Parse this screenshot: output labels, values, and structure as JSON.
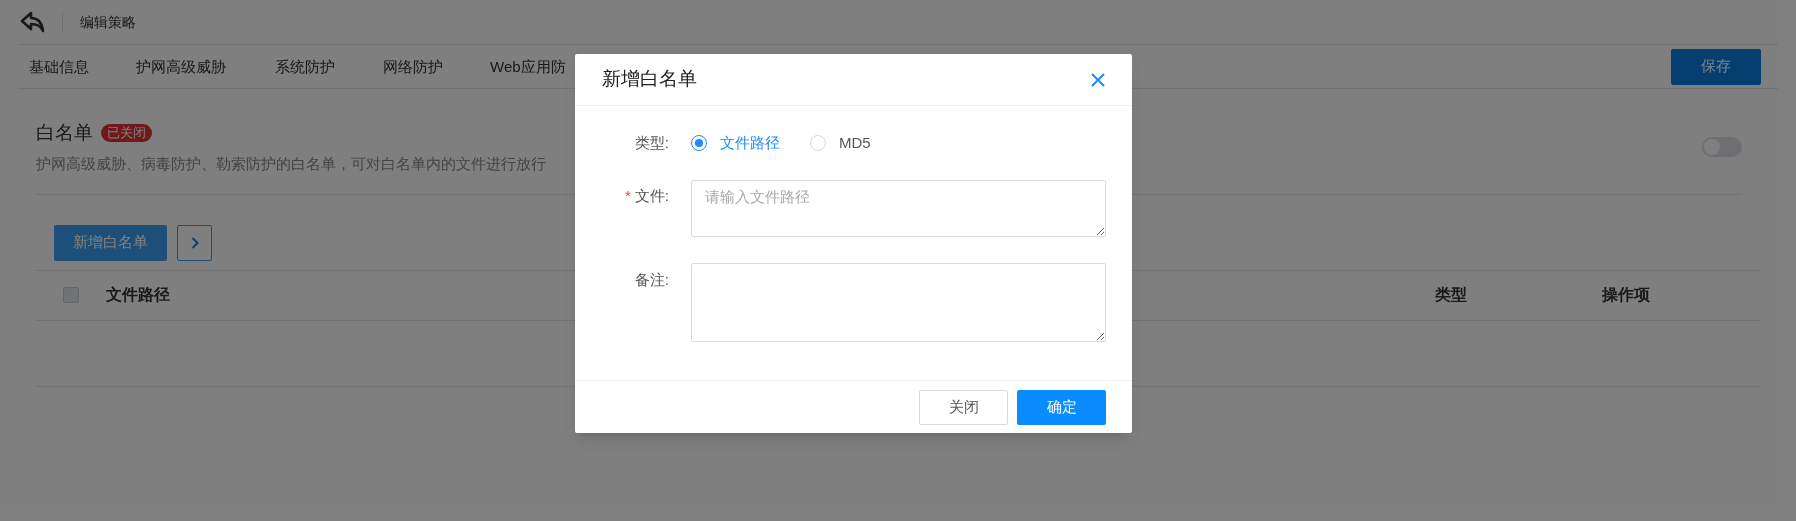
{
  "header": {
    "title": "编辑策略"
  },
  "tabs": [
    {
      "label": "基础信息"
    },
    {
      "label": "护网高级威胁"
    },
    {
      "label": "系统防护"
    },
    {
      "label": "网络防护"
    },
    {
      "label": "Web应用防"
    }
  ],
  "save_button": "保存",
  "section": {
    "title": "白名单",
    "badge": "已关闭",
    "description": "护网高级威胁、病毒防护、勒索防护的白名单，可对白名单内的文件进行放行",
    "toggle_on": false
  },
  "add_button": "新增白名单",
  "table": {
    "select_all_checked": false,
    "columns": [
      "文件路径",
      "类型",
      "操作项"
    ]
  },
  "dialog": {
    "title": "新增白名单",
    "type_field": {
      "label": "类型:",
      "options": [
        {
          "label": "文件路径",
          "selected": true
        },
        {
          "label": "MD5",
          "selected": false
        }
      ]
    },
    "file_field": {
      "label": "文件:",
      "required_mark": "*",
      "placeholder": "请输入文件路径"
    },
    "note_field": {
      "label": "备注:"
    },
    "buttons": [
      {
        "label": "关闭",
        "kind": "secondary"
      },
      {
        "label": "确定",
        "kind": "primary"
      }
    ]
  }
}
